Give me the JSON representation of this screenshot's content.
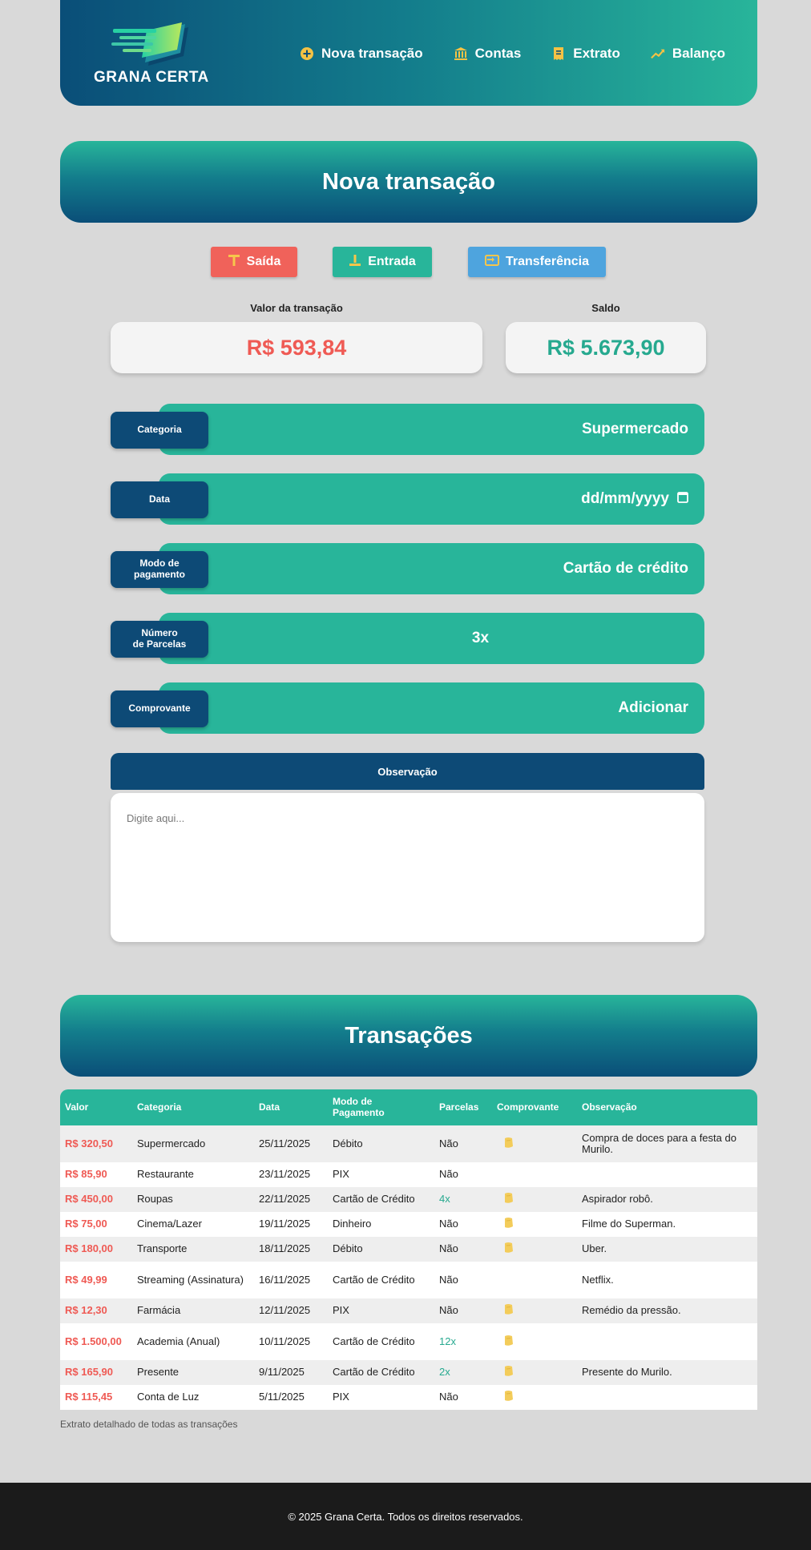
{
  "brand": {
    "name": "GRANA CERTA"
  },
  "nav": [
    {
      "label": "Nova transação",
      "icon": "plus-circle-icon"
    },
    {
      "label": "Contas",
      "icon": "bank-icon"
    },
    {
      "label": "Extrato",
      "icon": "receipt-icon"
    },
    {
      "label": "Balanço",
      "icon": "trend-up-icon"
    }
  ],
  "form": {
    "title": "Nova transação",
    "types": [
      {
        "label": "Saída",
        "icon": "arrow-up-icon",
        "color": "#f0625a"
      },
      {
        "label": "Entrada",
        "icon": "arrow-down-icon",
        "color": "#28b59a"
      },
      {
        "label": "Transferência",
        "icon": "transfer-icon",
        "color": "#4ea4de"
      }
    ],
    "valor_label": "Valor da transação",
    "valor": "R$ 593,84",
    "saldo_label": "Saldo",
    "saldo": "R$ 5.673,90",
    "fields": {
      "categoria": {
        "label": "Categoria",
        "value": "Supermercado"
      },
      "data": {
        "label": "Data",
        "placeholder": "dd/mm/yyyy"
      },
      "modo": {
        "label_1": "Modo de",
        "label_2": "pagamento",
        "value": "Cartão de crédito"
      },
      "parcelas": {
        "label_1": "Número",
        "label_2": "de Parcelas",
        "value": "3x"
      },
      "comprovante": {
        "label": "Comprovante",
        "value": "Adicionar"
      }
    },
    "observacao": {
      "label": "Observação",
      "placeholder": "Digite aqui..."
    }
  },
  "transacoes": {
    "title": "Transações",
    "columns": [
      "Valor",
      "Categoria",
      "Data",
      "Modo de Pagamento",
      "Parcelas",
      "Comprovante",
      "Observação"
    ],
    "rows": [
      {
        "valor": "R$ 320,50",
        "categoria": "Supermercado",
        "data": "25/11/2025",
        "modo": "Débito",
        "parcelas": "Não",
        "comprovante": true,
        "obs": "Compra de doces para a festa do Murilo."
      },
      {
        "valor": "R$ 85,90",
        "categoria": "Restaurante",
        "data": "23/11/2025",
        "modo": "PIX",
        "parcelas": "Não",
        "comprovante": false,
        "obs": ""
      },
      {
        "valor": "R$ 450,00",
        "categoria": "Roupas",
        "data": "22/11/2025",
        "modo": "Cartão de Crédito",
        "parcelas": "4x",
        "comprovante": true,
        "obs": "Aspirador robô."
      },
      {
        "valor": "R$ 75,00",
        "categoria": "Cinema/Lazer",
        "data": "19/11/2025",
        "modo": "Dinheiro",
        "parcelas": "Não",
        "comprovante": true,
        "obs": "Filme do Superman."
      },
      {
        "valor": "R$ 180,00",
        "categoria": "Transporte",
        "data": "18/11/2025",
        "modo": "Débito",
        "parcelas": "Não",
        "comprovante": true,
        "obs": "Uber."
      },
      {
        "valor": "R$ 49,99",
        "categoria": "Streaming (Assinatura)",
        "data": "16/11/2025",
        "modo": "Cartão de Crédito",
        "parcelas": "Não",
        "comprovante": false,
        "obs": "Netflix."
      },
      {
        "valor": "R$ 12,30",
        "categoria": "Farmácia",
        "data": "12/11/2025",
        "modo": "PIX",
        "parcelas": "Não",
        "comprovante": true,
        "obs": "Remédio da pressão."
      },
      {
        "valor": "R$ 1.500,00",
        "categoria": "Academia (Anual)",
        "data": "10/11/2025",
        "modo": "Cartão de Crédito",
        "parcelas": "12x",
        "comprovante": true,
        "obs": ""
      },
      {
        "valor": "R$ 165,90",
        "categoria": "Presente",
        "data": "9/11/2025",
        "modo": "Cartão de Crédito",
        "parcelas": "2x",
        "comprovante": true,
        "obs": "Presente do Murilo."
      },
      {
        "valor": "R$ 115,45",
        "categoria": "Conta de Luz",
        "data": "5/11/2025",
        "modo": "PIX",
        "parcelas": "Não",
        "comprovante": true,
        "obs": ""
      }
    ],
    "caption": "Extrato detalhado de todas as transações"
  },
  "footer": {
    "text": "© 2025 Grana Certa. Todos os direitos reservados."
  },
  "colors": {
    "teal": "#28b59a",
    "navy": "#0d4a76",
    "red": "#ef5a54",
    "blue": "#4ea4de",
    "receipt": "#f3cc5a"
  }
}
